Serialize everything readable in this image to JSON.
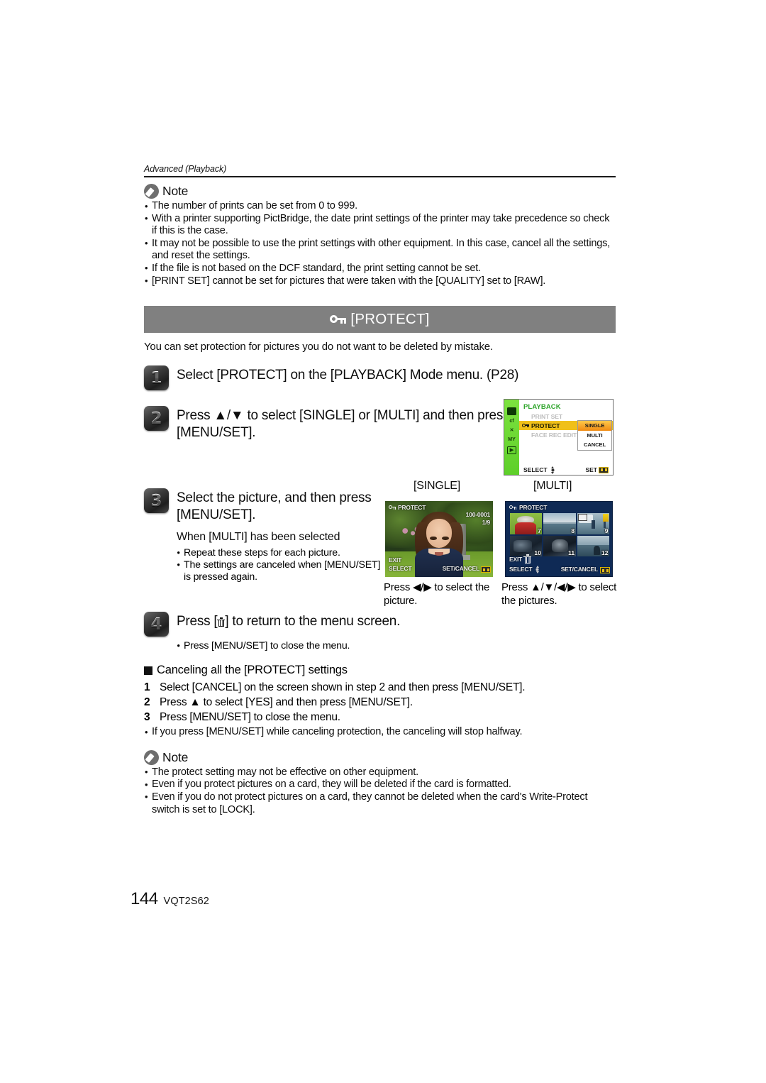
{
  "running_head": "Advanced (Playback)",
  "note_top": {
    "label": "Note",
    "bullets": [
      "The number of prints can be set from 0 to 999.",
      "With a printer supporting PictBridge, the date print settings of the printer may take precedence so check if this is the case.",
      "It may not be possible to use the print settings with other equipment. In this case, cancel all the settings, and reset the settings.",
      "If the file is not based on the DCF standard, the print setting cannot be set.",
      "[PRINT SET] cannot be set for pictures that were taken with the [QUALITY] set to [RAW]."
    ]
  },
  "banner": {
    "icon": "key-icon",
    "title": "[PROTECT]",
    "bg_color": "#808080",
    "text_color": "#FFFFFF"
  },
  "intro": "You can set protection for pictures you do not want to be deleted by mistake.",
  "steps": [
    {
      "number": "1",
      "text": "Select [PROTECT] on the [PLAYBACK] Mode menu. (P28)"
    },
    {
      "number": "2",
      "text": "Press ▲/▼ to select [SINGLE] or [MULTI] and then press [MENU/SET]."
    },
    {
      "number": "3",
      "text": "Select the picture, and then press [MENU/SET].",
      "sub_heading": "When [MULTI] has been selected",
      "sub_bullets": [
        "Repeat these steps for each picture.",
        "The settings are canceled when [MENU/SET] is pressed again."
      ]
    },
    {
      "number": "4",
      "text_before": "Press [",
      "text_after": "] to return to the menu screen.",
      "icon": "trash-icon",
      "bullets": [
        "Press [MENU/SET] to close the menu."
      ]
    }
  ],
  "menu_screen": {
    "title": "PLAYBACK",
    "sidebar_icons": [
      "camera-icon",
      "clock-icon",
      "wrench-icon",
      "my-menu-icon",
      "playback-icon"
    ],
    "rows": [
      {
        "label": "PRINT SET",
        "active": false,
        "icon": "print-icon"
      },
      {
        "label": "PROTECT",
        "active": true,
        "icon": "key-icon"
      },
      {
        "label": "FACE REC EDIT",
        "active": false,
        "icon": "face-icon"
      }
    ],
    "submenu": [
      {
        "label": "SINGLE",
        "selected": true
      },
      {
        "label": "MULTI",
        "selected": false
      },
      {
        "label": "CANCEL",
        "selected": false
      }
    ],
    "footer_left": "SELECT",
    "footer_right": "SET",
    "highlight_color": "#F0C01A",
    "submenu_highlight": "#F08A12",
    "title_color": "#2FA52B"
  },
  "lcd_single": {
    "label": "[SINGLE]",
    "overlay_title": "PROTECT",
    "file_number": "100-0001",
    "counter": "1/9",
    "exit": "EXIT",
    "select": "SELECT",
    "set_cancel": "SET/CANCEL",
    "caption": "Press ◀/▶ to select the picture."
  },
  "lcd_multi": {
    "label": "[MULTI]",
    "overlay_title": "PROTECT",
    "thumbnail_numbers": [
      "7",
      "8",
      "9",
      "10",
      "11",
      "12"
    ],
    "exit": "EXIT",
    "select": "SELECT",
    "set_cancel": "SET/CANCEL",
    "caption": "Press ▲/▼/◀/▶ to select the pictures.",
    "bg_color": "#0F2A55"
  },
  "cancel_section": {
    "heading": "Canceling all the [PROTECT] settings",
    "items": [
      {
        "n": "1",
        "text": "Select [CANCEL] on the screen shown in step 2 and then press [MENU/SET]."
      },
      {
        "n": "2",
        "text": "Press ▲ to select [YES] and then press [MENU/SET]."
      },
      {
        "n": "3",
        "text": "Press [MENU/SET] to close the menu."
      }
    ],
    "bullet": "If you press [MENU/SET] while canceling protection, the canceling will stop halfway."
  },
  "note_bottom": {
    "label": "Note",
    "bullets": [
      "The protect setting may not be effective on other equipment.",
      "Even if you protect pictures on a card, they will be deleted if the card is formatted.",
      "Even if you do not protect pictures on a card, they cannot be deleted when the card's Write-Protect switch is set to [LOCK]."
    ]
  },
  "footer": {
    "page_number": "144",
    "doc_code": "VQT2S62"
  }
}
